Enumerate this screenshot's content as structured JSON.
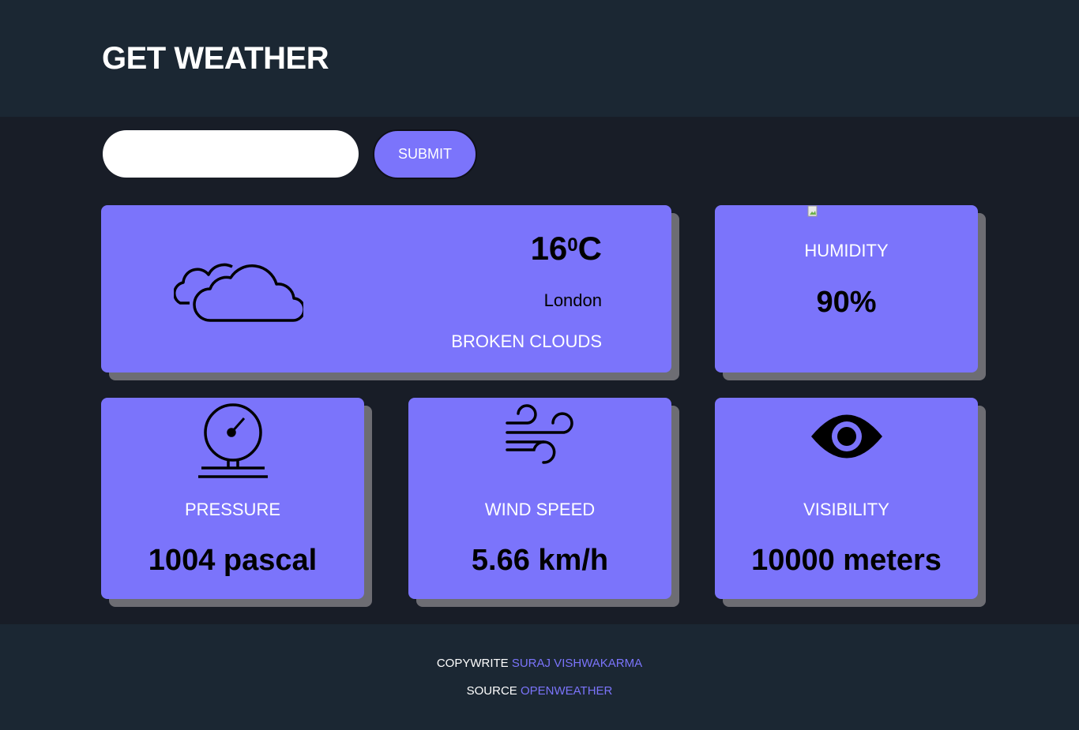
{
  "header": {
    "title": "GET WEATHER"
  },
  "search": {
    "value": "",
    "submit_label": "SUBMIT"
  },
  "current": {
    "temperature": "16",
    "degree_symbol": "0",
    "unit": "C",
    "city": "London",
    "condition": "BROKEN CLOUDS",
    "icon": "cloud-icon"
  },
  "humidity": {
    "label": "HUMIDITY",
    "value": "90%"
  },
  "pressure": {
    "label": "PRESSURE",
    "value": "1004 pascal",
    "icon": "gauge-icon"
  },
  "wind": {
    "label": "WIND SPEED",
    "value": "5.66 km/h",
    "icon": "wind-icon"
  },
  "visibility": {
    "label": "VISIBILITY",
    "value": "10000 meters",
    "icon": "eye-icon"
  },
  "footer": {
    "copyright_prefix": "COPYWRITE",
    "author": "SURAJ VISHWAKARMA",
    "source_prefix": "SOURCE",
    "source": "OPENWEATHER"
  },
  "colors": {
    "accent": "#7b74fb",
    "background": "#181d27",
    "header_bg": "#1b2733",
    "shadow": "#6d6d73"
  }
}
